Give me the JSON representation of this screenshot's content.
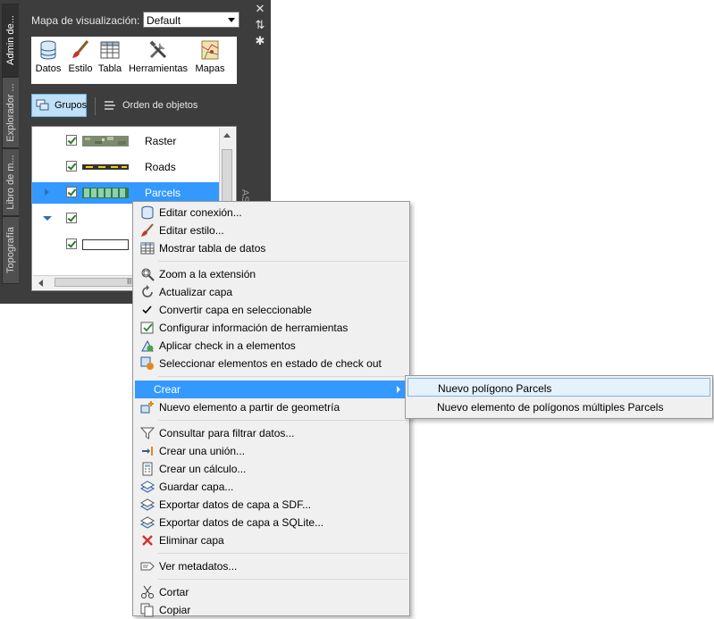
{
  "side_tabs": [
    "Admin de...",
    "Explorador ...",
    "Libro de m...",
    "Topografía"
  ],
  "side_caption": "AS",
  "title_controls": {
    "close": "✕",
    "autohide": "⇅",
    "settings": "✱"
  },
  "map": {
    "label": "Mapa de visualización:",
    "selected": "Default"
  },
  "toolbar": [
    {
      "label": "Datos",
      "icon": "database-icon"
    },
    {
      "label": "Estilo",
      "icon": "brush-icon"
    },
    {
      "label": "Tabla",
      "icon": "table-icon"
    },
    {
      "label": "Herramientas",
      "icon": "tools-icon"
    },
    {
      "label": "Mapas",
      "icon": "map-icon"
    }
  ],
  "view_tabs": {
    "groups": "Grupos",
    "order": "Orden de objetos"
  },
  "layers": [
    {
      "name": "Raster",
      "checked": true,
      "swatch": "raster"
    },
    {
      "name": "Roads",
      "checked": true,
      "swatch": "road"
    },
    {
      "name": "Parcels",
      "checked": true,
      "swatch": "parcels",
      "selected": true
    },
    {
      "name": "",
      "checked": true,
      "swatch": "none"
    },
    {
      "name": "",
      "checked": true,
      "swatch": "rect"
    }
  ],
  "scroll_grip": "III",
  "context_menu": {
    "items": [
      {
        "label": "Editar conexión...",
        "icon": "database-connect-icon"
      },
      {
        "label": "Editar estilo...",
        "icon": "brush-icon"
      },
      {
        "label": "Mostrar tabla de datos",
        "icon": "table-icon"
      },
      {
        "sep": true
      },
      {
        "label": "Zoom a la extensión",
        "icon": "zoom-extents-icon"
      },
      {
        "label": "Actualizar capa",
        "icon": "refresh-icon"
      },
      {
        "label": "Convertir capa en seleccionable",
        "icon": "checkmark-icon"
      },
      {
        "label": "Configurar información de herramientas",
        "icon": "tooltip-config-icon"
      },
      {
        "label": "Aplicar check in a elementos",
        "icon": "check-in-icon"
      },
      {
        "label": "Seleccionar elementos en estado de check out",
        "icon": "check-out-select-icon"
      },
      {
        "sep": true
      },
      {
        "label": "Crear",
        "highlighted": true,
        "submenu": true
      },
      {
        "label": "Nuevo elemento a partir de geometría",
        "icon": "new-feature-icon"
      },
      {
        "sep": true
      },
      {
        "label": "Consultar para filtrar datos...",
        "icon": "filter-icon"
      },
      {
        "label": "Crear una unión...",
        "icon": "join-icon"
      },
      {
        "label": "Crear un cálculo...",
        "icon": "calculator-icon"
      },
      {
        "label": "Guardar capa...",
        "icon": "save-layer-icon"
      },
      {
        "label": "Exportar datos de capa a SDF...",
        "icon": "export-sdf-icon"
      },
      {
        "label": "Exportar datos de capa a SQLite...",
        "icon": "export-sqlite-icon"
      },
      {
        "label": "Eliminar capa",
        "icon": "delete-icon"
      },
      {
        "sep": true
      },
      {
        "label": "Ver metadatos...",
        "icon": "metadata-icon"
      },
      {
        "sep": true
      },
      {
        "label": "Cortar",
        "icon": "cut-icon"
      },
      {
        "label": "Copiar",
        "icon": "copy-icon"
      }
    ]
  },
  "submenu": {
    "items": [
      {
        "label": "Nuevo polígono Parcels",
        "hover": true
      },
      {
        "label": "Nuevo elemento de polígonos múltiples Parcels"
      }
    ]
  },
  "colors": {
    "panel": "#3d3d3d",
    "highlight": "#3399ff",
    "menu_bg": "#f0f0f0",
    "check": "#2a7a2a"
  }
}
